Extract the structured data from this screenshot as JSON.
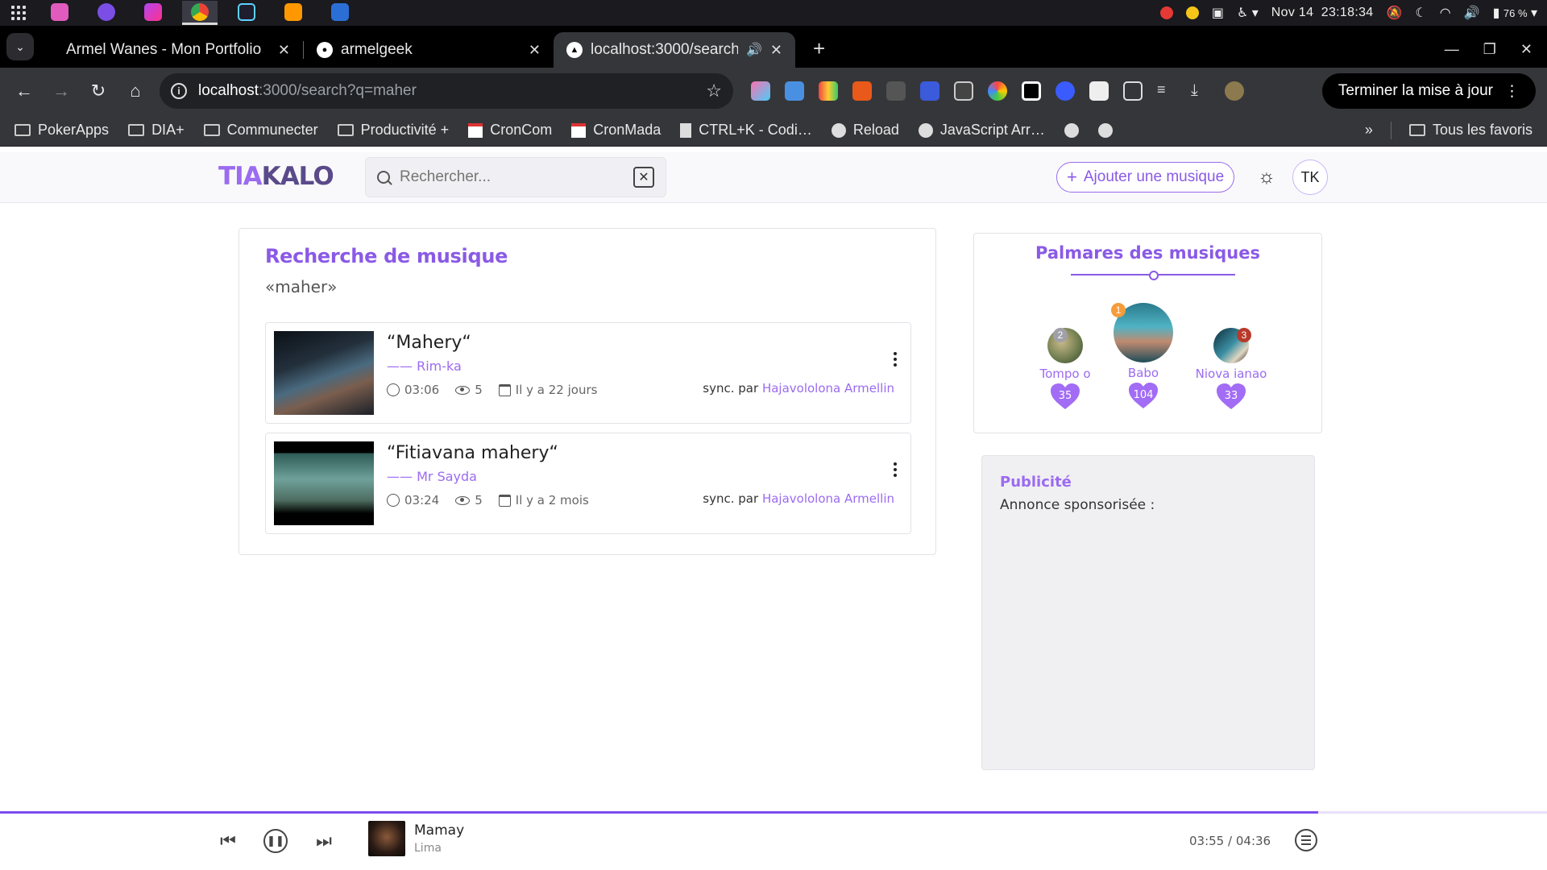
{
  "system": {
    "date": "Nov 14",
    "time": "23:18:34",
    "battery": "76 %"
  },
  "browser": {
    "tabs": [
      {
        "title": "Armel Wanes - Mon Portfolio",
        "active": false
      },
      {
        "title": "armelgeek",
        "active": false
      },
      {
        "title": "localhost:3000/search?q=maher",
        "active": true
      }
    ],
    "url_host": "localhost",
    "url_path": ":3000/search?q=maher",
    "update_label": "Terminer la mise à jour",
    "bookmarks": [
      {
        "label": "PokerApps",
        "icon": "folder-icon"
      },
      {
        "label": "DIA+",
        "icon": "folder-icon"
      },
      {
        "label": "Communecter",
        "icon": "folder-icon"
      },
      {
        "label": "Productivité +",
        "icon": "folder-icon"
      },
      {
        "label": "CronCom",
        "icon": "calendar-icon"
      },
      {
        "label": "CronMada",
        "icon": "calendar-icon"
      },
      {
        "label": "CTRL+K - Codi…",
        "icon": "doc-icon"
      },
      {
        "label": "Reload",
        "icon": "globe-icon"
      },
      {
        "label": "JavaScript Arr…",
        "icon": "globe-icon"
      }
    ],
    "all_bookmarks_label": "Tous les favoris"
  },
  "site": {
    "logo_part1": "TIA",
    "logo_part2": "KALO",
    "search_placeholder": "Rechercher...",
    "add_music_label": "Ajouter une musique",
    "avatar_initials": "TK"
  },
  "results": {
    "title": "Recherche de musique",
    "query": "«maher»",
    "items": [
      {
        "title": "“Mahery“",
        "artist": "Rim-ka",
        "duration": "03:06",
        "views": "5",
        "date": "Il y a 22 jours",
        "sync_prefix": "sync. par",
        "sync_by": "Hajavololona Armellin"
      },
      {
        "title": "“Fitiavana mahery“",
        "artist": "Mr Sayda",
        "duration": "03:24",
        "views": "5",
        "date": "Il y a 2 mois",
        "sync_prefix": "sync. par",
        "sync_by": "Hajavololona Armellin"
      }
    ]
  },
  "palmares": {
    "title": "Palmares des musiques",
    "ranks": [
      {
        "rank": "2",
        "name": "Tompo o",
        "likes": "35",
        "badge_color": "#a0a0a8"
      },
      {
        "rank": "1",
        "name": "Babo",
        "likes": "104",
        "badge_color": "#f59c3b"
      },
      {
        "rank": "3",
        "name": "Niova ianao",
        "likes": "33",
        "badge_color": "#b83a2a"
      }
    ]
  },
  "ad": {
    "title": "Publicité",
    "subtitle": "Annonce sponsorisée :"
  },
  "player": {
    "title": "Mamay",
    "artist": "Lima",
    "time_current": "03:55",
    "time_separator": "/",
    "time_total": "04:36",
    "progress": 0.852
  },
  "colors": {
    "accent": "#9b6bf0",
    "accent_dark": "#8a5ae6",
    "heart": "#a26cf5"
  }
}
